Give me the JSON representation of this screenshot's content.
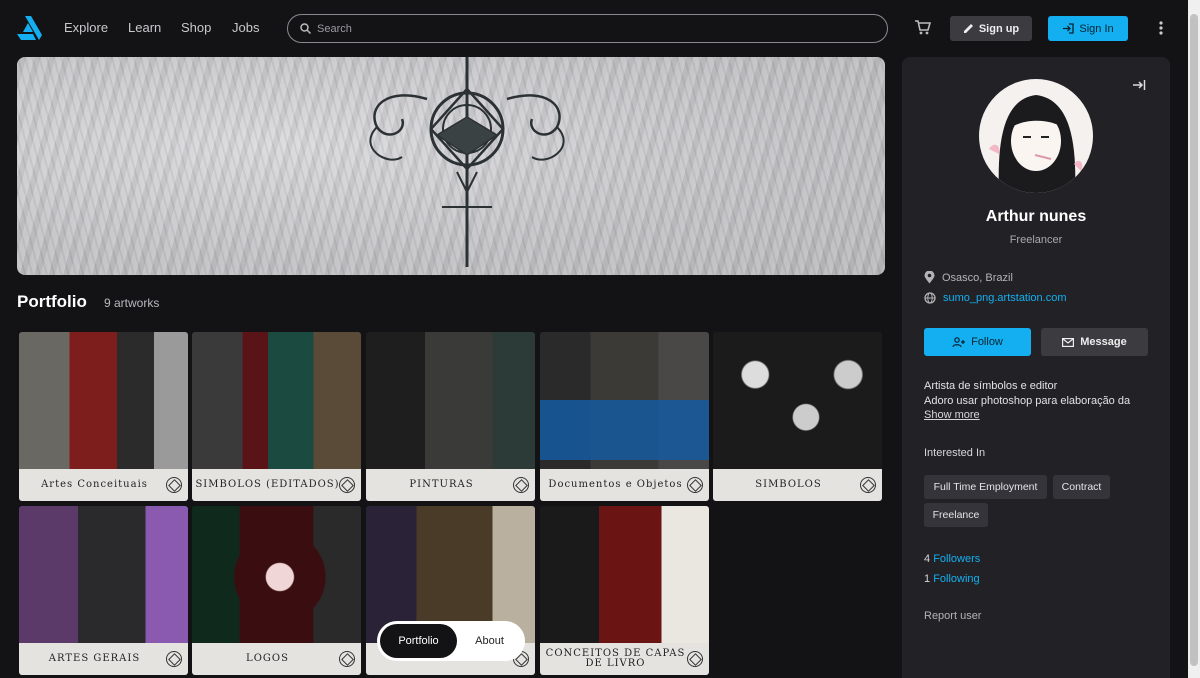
{
  "nav": {
    "links": [
      "Explore",
      "Learn",
      "Shop",
      "Jobs"
    ],
    "search_placeholder": "Search",
    "signup_label": "Sign up",
    "signin_label": "Sign In"
  },
  "portfolio": {
    "title": "Portfolio",
    "count": "9 artworks",
    "items": [
      {
        "label": "Artes Conceituais"
      },
      {
        "label": "SIMBOLOS (EDITADOS)"
      },
      {
        "label": "PINTURAS"
      },
      {
        "label": "Documentos e Objetos"
      },
      {
        "label": "SIMBOLOS"
      },
      {
        "label": "ARTES GERAIS"
      },
      {
        "label": "LOGOS"
      },
      {
        "label": ""
      },
      {
        "label": "CONCEITOS DE CAPAS DE LIVRO"
      }
    ]
  },
  "tabs": {
    "active": "Portfolio",
    "inactive": "About"
  },
  "profile": {
    "name": "Arthur nunes",
    "role": "Freelancer",
    "location": "Osasco, Brazil",
    "website": "sumo_png.artstation.com",
    "follow_label": "Follow",
    "message_label": "Message",
    "bio_line1": "Artista de símbolos e editor",
    "bio_line2": "Adoro usar photoshop para elaboração da",
    "show_more": "Show more",
    "interested_title": "Interested In",
    "interests": [
      "Full Time Employment",
      "Contract",
      "Freelance"
    ],
    "followers_count": "4",
    "followers_label": "Followers",
    "following_count": "1",
    "following_label": "Following",
    "report": "Report user"
  },
  "colors": {
    "accent": "#13aff0",
    "background": "#131316",
    "panel": "#222226"
  }
}
